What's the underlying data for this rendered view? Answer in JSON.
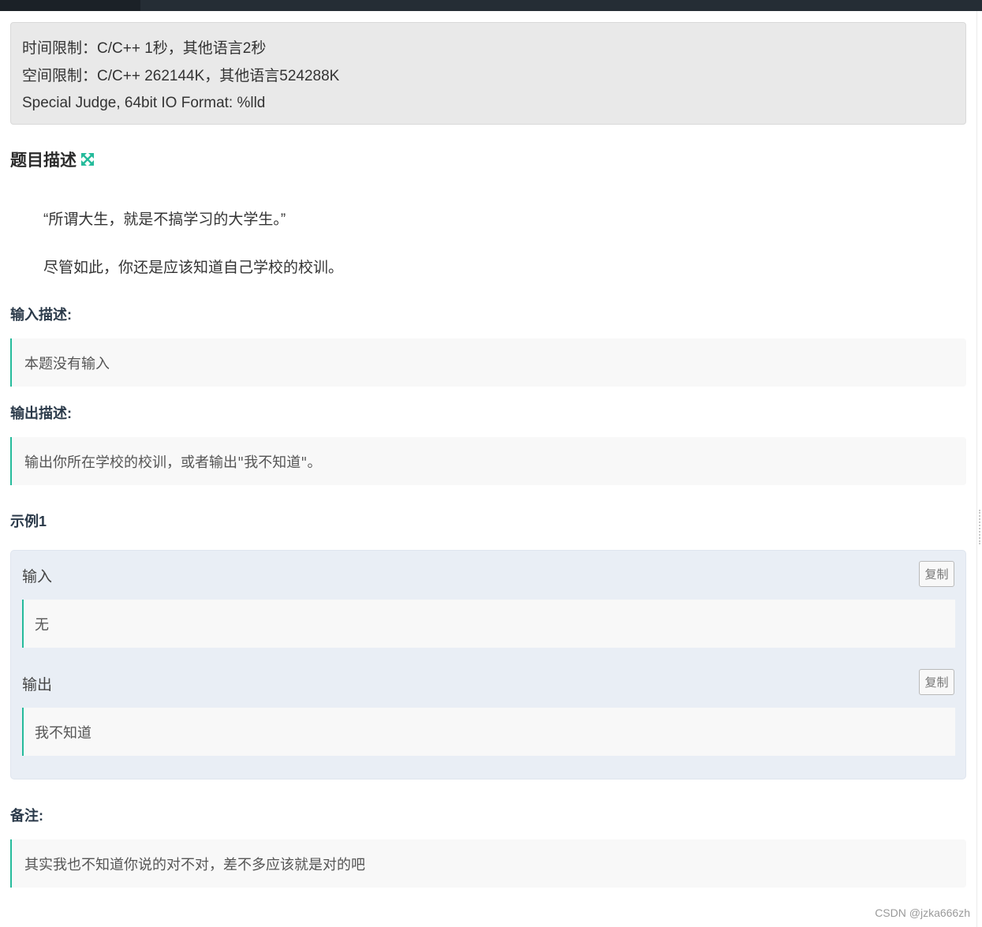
{
  "limits": {
    "time": "时间限制：C/C++ 1秒，其他语言2秒",
    "space": "空间限制：C/C++ 262144K，其他语言524288K",
    "judge": "Special Judge, 64bit IO Format: %lld"
  },
  "description": {
    "title": "题目描述",
    "expand_icon": "expand-arrows-icon",
    "accent_color": "#25bb9b",
    "paragraphs": [
      "“所谓大生，就是不搞学习的大学生。”",
      "尽管如此，你还是应该知道自己学校的校训。"
    ]
  },
  "input": {
    "title": "输入描述:",
    "text": "本题没有输入"
  },
  "output": {
    "title": "输出描述:",
    "text": "输出你所在学校的校训，或者输出\"我不知道\"。"
  },
  "example": {
    "title": "示例1",
    "input_label": "输入",
    "input_value": "无",
    "output_label": "输出",
    "output_value": "我不知道",
    "copy_label": "复制"
  },
  "note": {
    "title": "备注:",
    "text": "其实我也不知道你说的对不对，差不多应该就是对的吧"
  },
  "watermark": "CSDN @jzka666zh"
}
